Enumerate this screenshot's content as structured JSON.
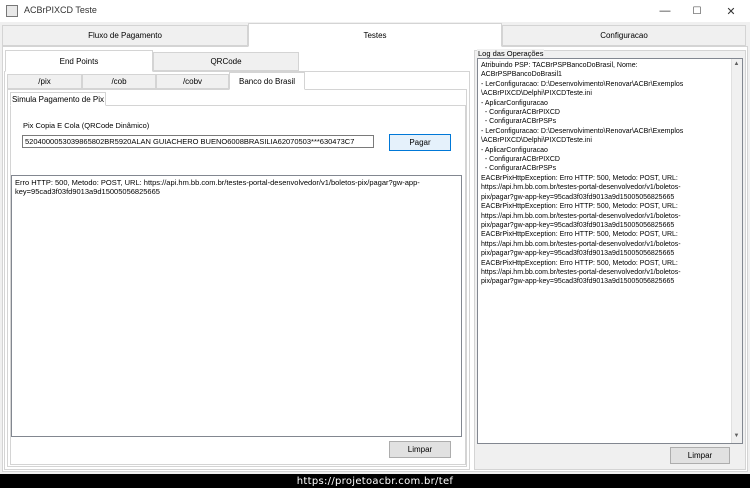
{
  "window": {
    "title": "ACBrPIXCD Teste",
    "minimize": "—",
    "maximize": "☐",
    "close": "✕"
  },
  "main_tabs": [
    {
      "label": "Fluxo de Pagamento"
    },
    {
      "label": "Testes"
    },
    {
      "label": "Configuracao"
    }
  ],
  "sub_tabs": [
    {
      "label": "End Points"
    },
    {
      "label": "QRCode"
    }
  ],
  "endpoint_tabs": [
    {
      "label": "/pix"
    },
    {
      "label": "/cob"
    },
    {
      "label": "/cobv"
    },
    {
      "label": "Banco do Brasil"
    }
  ],
  "bb_tabs": [
    {
      "label": "Simula Pagamento de Pix"
    }
  ],
  "simula": {
    "field_label": "Pix Copia E Cola  (QRCode Dinâmico)",
    "field_value": "5204000053039865802BR5920ALAN GUIACHERO BUENO6008BRASILIA62070503***630473C7",
    "pagar_label": "Pagar",
    "result_text": "Erro HTTP: 500, Metodo: POST, URL: https://api.hm.bb.com.br/testes-portal-desenvolvedor/v1/boletos-pix/pagar?gw-app-key=95cad3f03fd9013a9d15005056825665",
    "limpar_label": "Limpar"
  },
  "log": {
    "title": "Log das Operações",
    "text": "Atribuindo PSP: TACBrPSPBancoDoBrasil, Nome:\nACBrPSPBancoDoBrasil1\n- LerConfiguracao: D:\\Desenvolvimento\\Renovar\\ACBr\\Exemplos\n\\ACBrPIXCD\\Delphi\\PIXCDTeste.ini\n- AplicarConfiguracao\n  - ConfigurarACBrPIXCD\n  - ConfigurarACBrPSPs\n- LerConfiguracao: D:\\Desenvolvimento\\Renovar\\ACBr\\Exemplos\n\\ACBrPIXCD\\Delphi\\PIXCDTeste.ini\n- AplicarConfiguracao\n  - ConfigurarACBrPIXCD\n  - ConfigurarACBrPSPs\nEACBrPixHttpException: Erro HTTP: 500, Metodo: POST, URL:\nhttps://api.hm.bb.com.br/testes-portal-desenvolvedor/v1/boletos-\npix/pagar?gw-app-key=95cad3f03fd9013a9d15005056825665\nEACBrPixHttpException: Erro HTTP: 500, Metodo: POST, URL:\nhttps://api.hm.bb.com.br/testes-portal-desenvolvedor/v1/boletos-\npix/pagar?gw-app-key=95cad3f03fd9013a9d15005056825665\nEACBrPixHttpException: Erro HTTP: 500, Metodo: POST, URL:\nhttps://api.hm.bb.com.br/testes-portal-desenvolvedor/v1/boletos-\npix/pagar?gw-app-key=95cad3f03fd9013a9d15005056825665\nEACBrPixHttpException: Erro HTTP: 500, Metodo: POST, URL:\nhttps://api.hm.bb.com.br/testes-portal-desenvolvedor/v1/boletos-\npix/pagar?gw-app-key=95cad3f03fd9013a9d15005056825665",
    "limpar_label": "Limpar"
  },
  "footer": {
    "text": "https://projetoacbr.com.br/tef"
  },
  "icons": {
    "app": "app-icon"
  }
}
